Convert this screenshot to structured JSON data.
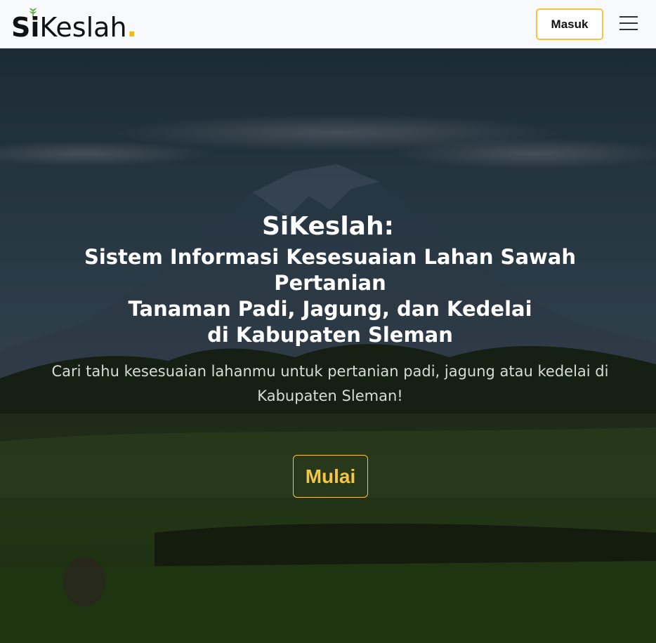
{
  "navbar": {
    "logo": {
      "prefix": "Si",
      "rest": "Keslah",
      "dot": "."
    },
    "login_label": "Masuk",
    "menu_icon": "hamburger-menu-icon"
  },
  "hero": {
    "brand": "SiKeslah:",
    "title_lines": [
      "Sistem Informasi Kesesuaian Lahan Sawah Pertanian",
      "Tanaman Padi, Jagung, dan Kedelai",
      "di Kabupaten Sleman"
    ],
    "subtitle": "Cari tahu kesesuaian lahanmu untuk pertanian padi, jagung atau kedelai di Kabupaten Sleman!",
    "cta_label": "Mulai",
    "background": "mountain-rice-field-photo"
  },
  "colors": {
    "accent": "#f5c542",
    "logo_dot": "#f5b90f",
    "navbar_bg": "#f8f9fa",
    "leaf": "#6aa84f"
  }
}
